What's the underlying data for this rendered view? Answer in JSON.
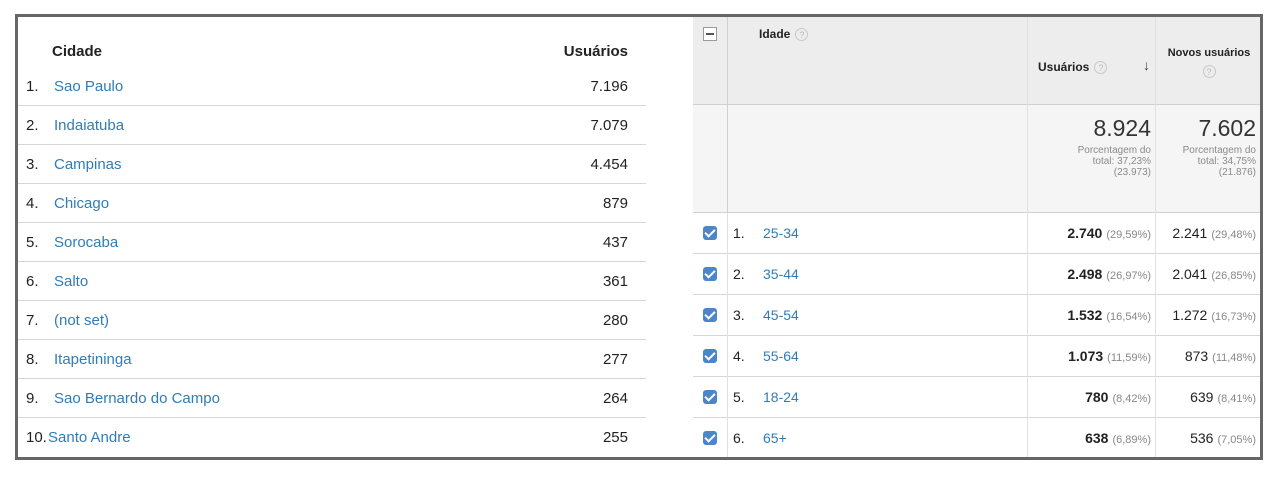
{
  "cities": {
    "header_city": "Cidade",
    "header_users": "Usuários",
    "rows": [
      {
        "rank": "1.",
        "name": "Sao Paulo",
        "users": "7.196"
      },
      {
        "rank": "2.",
        "name": "Indaiatuba",
        "users": "7.079"
      },
      {
        "rank": "3.",
        "name": "Campinas",
        "users": "4.454"
      },
      {
        "rank": "4.",
        "name": "Chicago",
        "users": "879"
      },
      {
        "rank": "5.",
        "name": "Sorocaba",
        "users": "437"
      },
      {
        "rank": "6.",
        "name": "Salto",
        "users": "361"
      },
      {
        "rank": "7.",
        "name": "(not set)",
        "users": "280"
      },
      {
        "rank": "8.",
        "name": "Itapetininga",
        "users": "277"
      },
      {
        "rank": "9.",
        "name": "Sao Bernardo do Campo",
        "users": "264"
      },
      {
        "rank": "10.",
        "name": "Santo Andre",
        "users": "255"
      }
    ]
  },
  "ages": {
    "header_age": "Idade",
    "header_users": "Usuários",
    "header_new_users": "Novos usuários",
    "help_glyph": "?",
    "sort_glyph": "↓",
    "totals": {
      "users": "8.924",
      "users_line1": "Porcentagem do",
      "users_line2": "total: 37,23%",
      "users_line3": "(23.973)",
      "new_users": "7.602",
      "new_line1": "Porcentagem do",
      "new_line2": "total: 34,75%",
      "new_line3": "(21.876)"
    },
    "rows": [
      {
        "rank": "1.",
        "age": "25-34",
        "users": "2.740",
        "users_pct": "(29,59%)",
        "new_users": "2.241",
        "new_pct": "(29,48%)",
        "checked": true
      },
      {
        "rank": "2.",
        "age": "35-44",
        "users": "2.498",
        "users_pct": "(26,97%)",
        "new_users": "2.041",
        "new_pct": "(26,85%)",
        "checked": true
      },
      {
        "rank": "3.",
        "age": "45-54",
        "users": "1.532",
        "users_pct": "(16,54%)",
        "new_users": "1.272",
        "new_pct": "(16,73%)",
        "checked": true
      },
      {
        "rank": "4.",
        "age": "55-64",
        "users": "1.073",
        "users_pct": "(11,59%)",
        "new_users": "873",
        "new_pct": "(11,48%)",
        "checked": true
      },
      {
        "rank": "5.",
        "age": "18-24",
        "users": "780",
        "users_pct": "(8,42%)",
        "new_users": "639",
        "new_pct": "(8,41%)",
        "checked": true
      },
      {
        "rank": "6.",
        "age": "65+",
        "users": "638",
        "users_pct": "(6,89%)",
        "new_users": "536",
        "new_pct": "(7,05%)",
        "checked": true
      }
    ]
  },
  "colors": {
    "link": "#2f7db8",
    "checkbox": "#4a86c8",
    "header_bg": "#ededed"
  }
}
